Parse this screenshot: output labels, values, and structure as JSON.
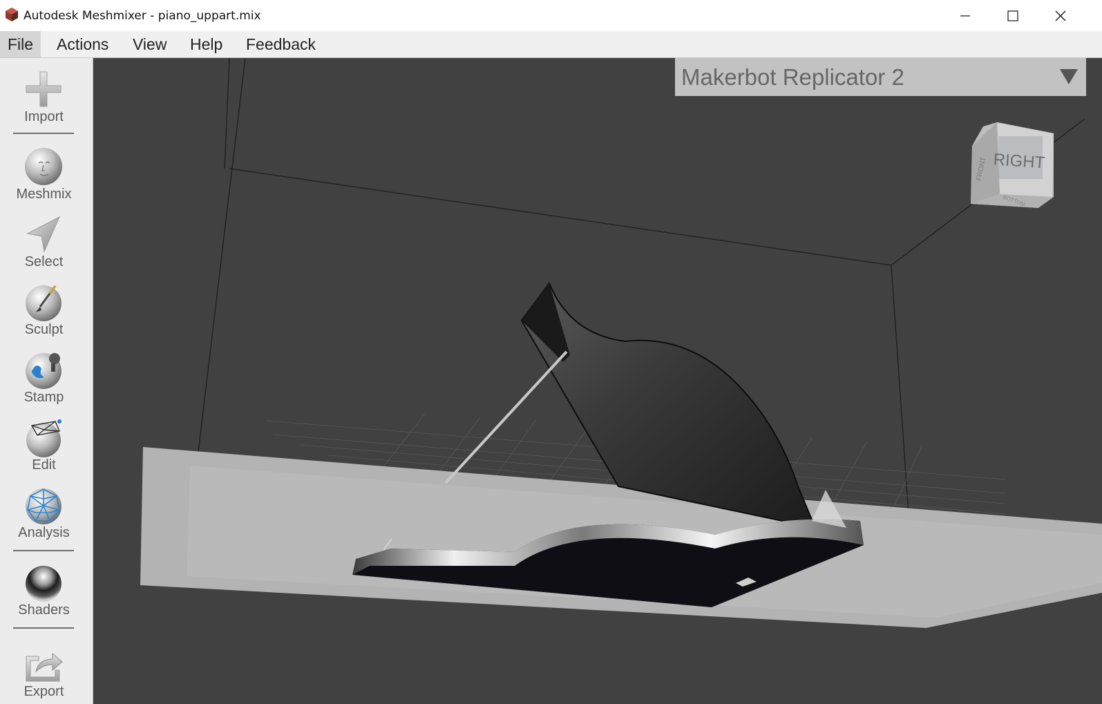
{
  "window": {
    "app_title": "Autodesk Meshmixer - piano_uppart.mix",
    "minimize_icon": "minimize-icon",
    "maximize_icon": "maximize-icon",
    "close_icon": "close-icon"
  },
  "menu": {
    "items": [
      "File",
      "Actions",
      "View",
      "Help",
      "Feedback"
    ],
    "active": "File"
  },
  "toolbar": {
    "tools": [
      {
        "label": "Import",
        "icon": "plus-icon"
      },
      {
        "label": "Meshmix",
        "icon": "face-sphere-icon"
      },
      {
        "label": "Select",
        "icon": "arrow-cursor-icon"
      },
      {
        "label": "Sculpt",
        "icon": "brush-sphere-icon"
      },
      {
        "label": "Stamp",
        "icon": "stamp-sphere-icon"
      },
      {
        "label": "Edit",
        "icon": "wire-edit-sphere-icon"
      },
      {
        "label": "Analysis",
        "icon": "mesh-network-sphere-icon"
      },
      {
        "label": "Shaders",
        "icon": "chrome-sphere-icon"
      },
      {
        "label": "Export",
        "icon": "export-arrow-icon"
      }
    ]
  },
  "viewport": {
    "printer": "Makerbot Replicator 2",
    "viewcube_right": "RIGHT",
    "viewcube_front": "FRONT",
    "viewcube_bottom": "BOTTOM",
    "background": "#414141"
  }
}
